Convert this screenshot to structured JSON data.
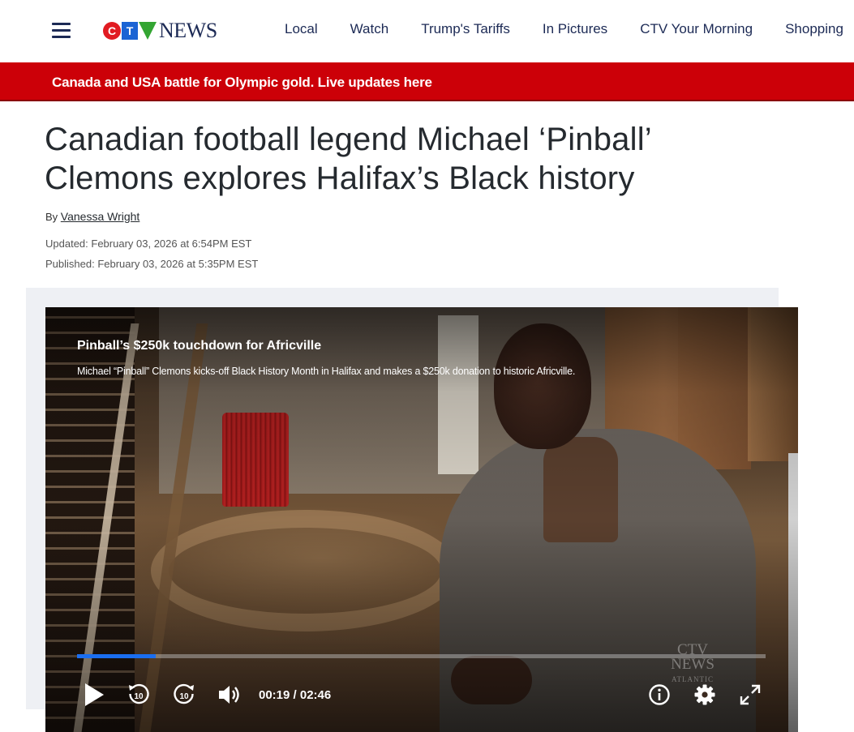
{
  "header": {
    "menu_icon": "hamburger-menu-icon",
    "logo": {
      "letters": [
        "C",
        "T",
        "V"
      ],
      "wordmark": "NEWS"
    },
    "nav": [
      {
        "label": "Local"
      },
      {
        "label": "Watch"
      },
      {
        "label": "Trump's Tariffs"
      },
      {
        "label": "In Pictures"
      },
      {
        "label": "CTV Your Morning"
      },
      {
        "label": "Shopping"
      }
    ]
  },
  "banner": {
    "text": "Canada and USA battle for Olympic gold. Live updates here",
    "color": "#cc0008"
  },
  "article": {
    "headline": "Canadian football legend Michael ‘Pinball’ Clemons explores Halifax’s Black history",
    "by_prefix": "By",
    "author": "Vanessa Wright",
    "updated": "Updated: February 03, 2026 at 6:54PM EST",
    "published": "Published: February 03, 2026 at 5:35PM EST"
  },
  "video": {
    "title": "Pinball’s $250k touchdown for Africville",
    "description": "Michael “Pinball” Clemons kicks-off Black History Month in Halifax and makes a $250k donation to historic Africville.",
    "watermark": {
      "logo": "CTV",
      "wordmark": "NEWS",
      "region": "ATLANTIC"
    },
    "current_time": "00:19",
    "duration": "02:46",
    "time_display": "00:19 / 02:46",
    "progress_fraction": 0.114,
    "progress_color": "#1a6ef0",
    "controls": {
      "play": "play-icon",
      "rewind": "rewind-10-icon",
      "forward": "forward-10-icon",
      "volume": "volume-icon",
      "info": "info-icon",
      "settings": "gear-icon",
      "fullscreen": "fullscreen-icon"
    },
    "skip_seconds": "10"
  }
}
